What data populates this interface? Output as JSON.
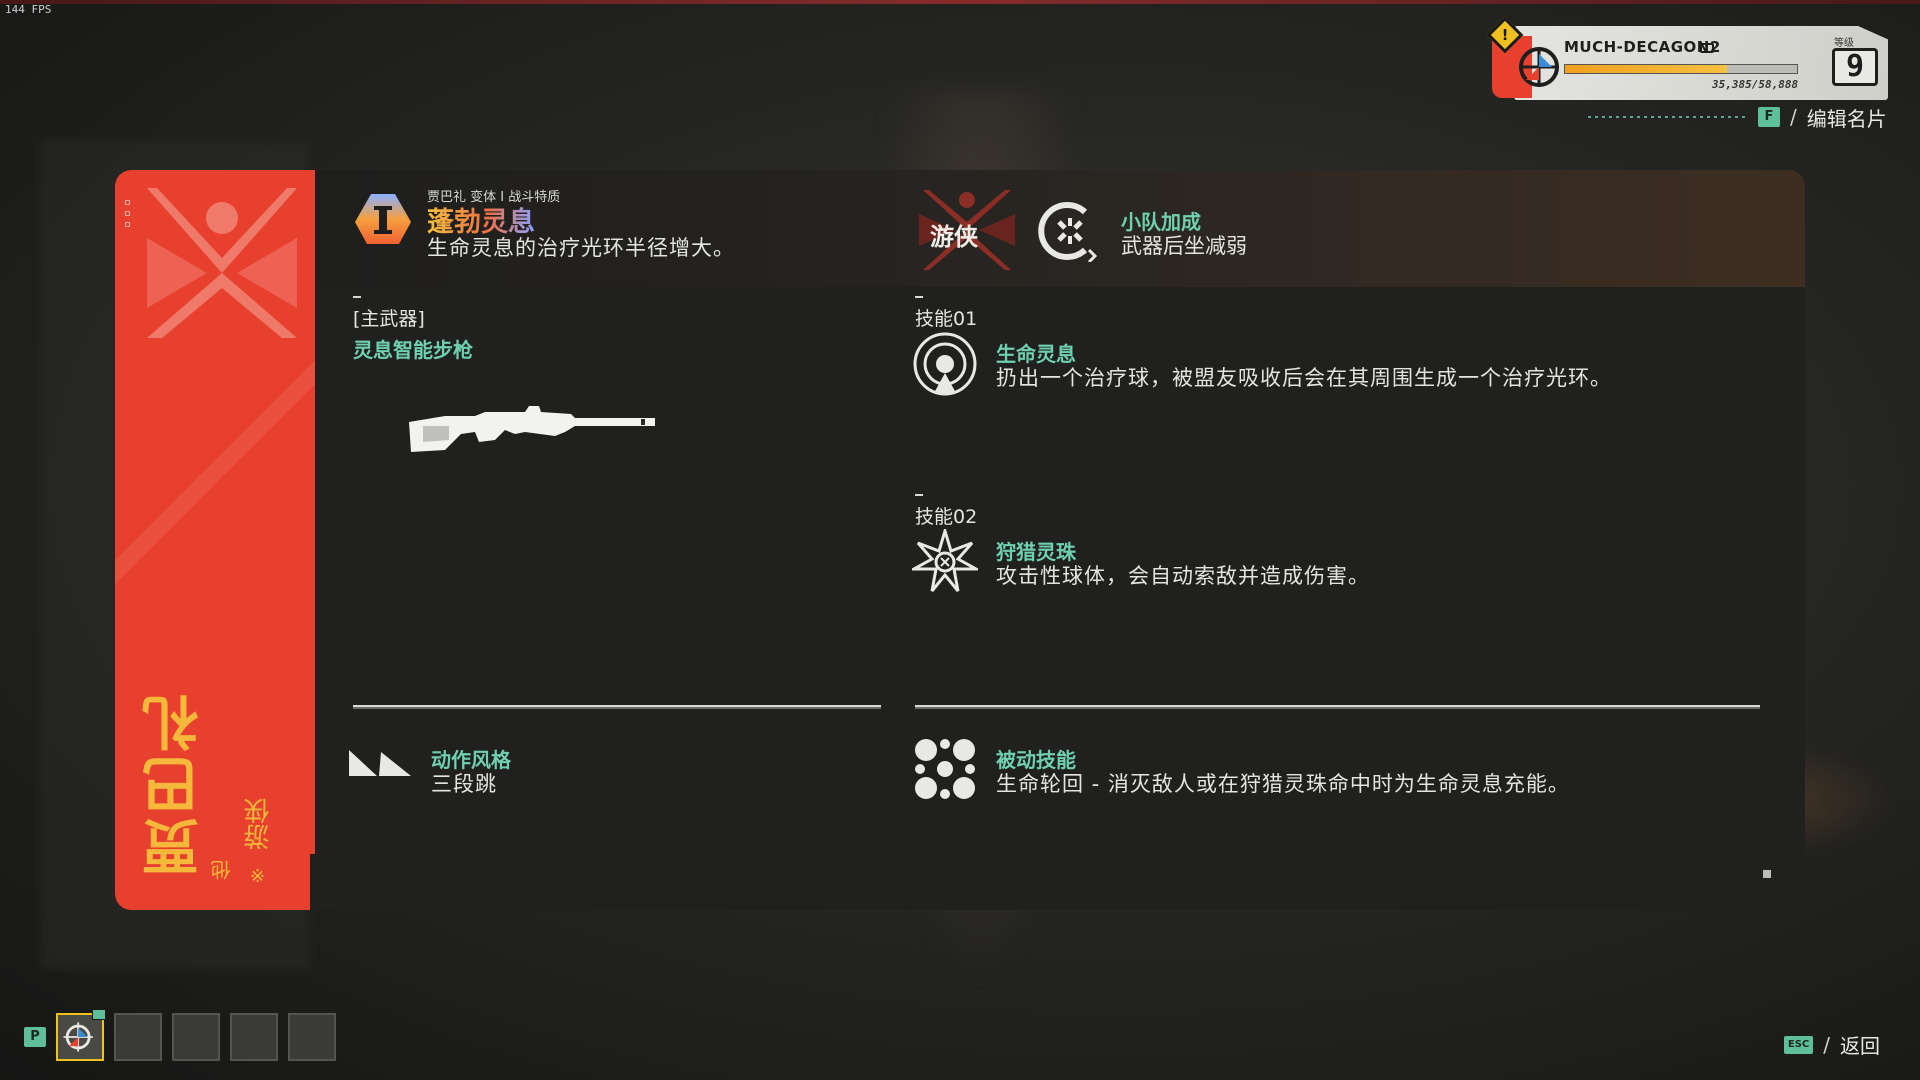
{
  "overlay": {
    "fps": "144 FPS"
  },
  "profile": {
    "player_name": "MUCH-DECAGON2",
    "level_label": "等级",
    "level": "9",
    "xp_text": "35,385/58,888",
    "xp_progress_fraction": 0.7,
    "edit_key": "F",
    "edit_label": "编辑名片"
  },
  "hero": {
    "name": "贾巴礼",
    "pronoun": "他",
    "class": "游侠",
    "accent_color": "#e8402e",
    "name_color": "#f5b83a"
  },
  "perk": {
    "subtitle": "贾巴礼 变体 I 战斗特质",
    "title": "蓬勃灵息",
    "description": "生命灵息的治疗光环半径增大。",
    "icon": "roman-one-icon"
  },
  "class_badge": {
    "label": "游侠"
  },
  "squad_bonus": {
    "title": "小队加成",
    "description": "武器后坐减弱",
    "icon": "recoil-reduction-icon"
  },
  "weapon": {
    "slot_label": "[主武器]",
    "name": "灵息智能步枪",
    "icon": "rifle-icon"
  },
  "skills": [
    {
      "slot_label": "技能01",
      "name": "生命灵息",
      "description": "扔出一个治疗球，被盟友吸收后会在其周围生成一个治疗光环。",
      "icon": "life-orb-icon"
    },
    {
      "slot_label": "技能02",
      "name": "狩猎灵珠",
      "description": "攻击性球体，会自动索敌并造成伤害。",
      "icon": "hunting-orb-icon"
    }
  ],
  "movement": {
    "title": "动作风格",
    "description": "三段跳",
    "icon": "triple-jump-icon"
  },
  "passive": {
    "title": "被动技能",
    "description": "生命轮回 - 消灭敌人或在狩猎灵珠命中时为生命灵息充能。",
    "icon": "passive-cluster-icon"
  },
  "footer": {
    "loadout_key": "P",
    "back_key": "ESC",
    "back_label": "返回"
  },
  "colors": {
    "accent_green": "#6fd0b0",
    "key_green": "#5fbf9a",
    "xp_orange": "#f0a020"
  }
}
